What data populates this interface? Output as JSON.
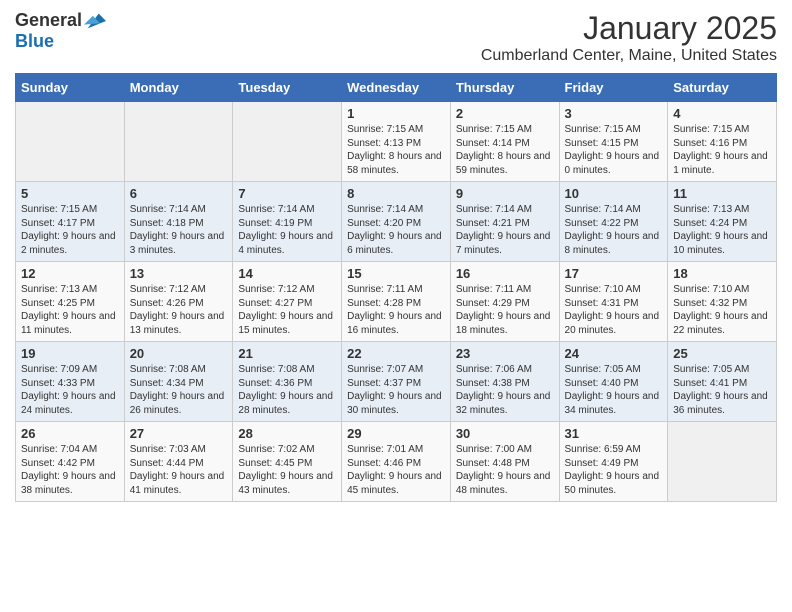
{
  "logo": {
    "general": "General",
    "blue": "Blue"
  },
  "header": {
    "month": "January 2025",
    "location": "Cumberland Center, Maine, United States"
  },
  "weekdays": [
    "Sunday",
    "Monday",
    "Tuesday",
    "Wednesday",
    "Thursday",
    "Friday",
    "Saturday"
  ],
  "weeks": [
    [
      {
        "day": "",
        "sunrise": "",
        "sunset": "",
        "daylight": ""
      },
      {
        "day": "",
        "sunrise": "",
        "sunset": "",
        "daylight": ""
      },
      {
        "day": "",
        "sunrise": "",
        "sunset": "",
        "daylight": ""
      },
      {
        "day": "1",
        "sunrise": "Sunrise: 7:15 AM",
        "sunset": "Sunset: 4:13 PM",
        "daylight": "Daylight: 8 hours and 58 minutes."
      },
      {
        "day": "2",
        "sunrise": "Sunrise: 7:15 AM",
        "sunset": "Sunset: 4:14 PM",
        "daylight": "Daylight: 8 hours and 59 minutes."
      },
      {
        "day": "3",
        "sunrise": "Sunrise: 7:15 AM",
        "sunset": "Sunset: 4:15 PM",
        "daylight": "Daylight: 9 hours and 0 minutes."
      },
      {
        "day": "4",
        "sunrise": "Sunrise: 7:15 AM",
        "sunset": "Sunset: 4:16 PM",
        "daylight": "Daylight: 9 hours and 1 minute."
      }
    ],
    [
      {
        "day": "5",
        "sunrise": "Sunrise: 7:15 AM",
        "sunset": "Sunset: 4:17 PM",
        "daylight": "Daylight: 9 hours and 2 minutes."
      },
      {
        "day": "6",
        "sunrise": "Sunrise: 7:14 AM",
        "sunset": "Sunset: 4:18 PM",
        "daylight": "Daylight: 9 hours and 3 minutes."
      },
      {
        "day": "7",
        "sunrise": "Sunrise: 7:14 AM",
        "sunset": "Sunset: 4:19 PM",
        "daylight": "Daylight: 9 hours and 4 minutes."
      },
      {
        "day": "8",
        "sunrise": "Sunrise: 7:14 AM",
        "sunset": "Sunset: 4:20 PM",
        "daylight": "Daylight: 9 hours and 6 minutes."
      },
      {
        "day": "9",
        "sunrise": "Sunrise: 7:14 AM",
        "sunset": "Sunset: 4:21 PM",
        "daylight": "Daylight: 9 hours and 7 minutes."
      },
      {
        "day": "10",
        "sunrise": "Sunrise: 7:14 AM",
        "sunset": "Sunset: 4:22 PM",
        "daylight": "Daylight: 9 hours and 8 minutes."
      },
      {
        "day": "11",
        "sunrise": "Sunrise: 7:13 AM",
        "sunset": "Sunset: 4:24 PM",
        "daylight": "Daylight: 9 hours and 10 minutes."
      }
    ],
    [
      {
        "day": "12",
        "sunrise": "Sunrise: 7:13 AM",
        "sunset": "Sunset: 4:25 PM",
        "daylight": "Daylight: 9 hours and 11 minutes."
      },
      {
        "day": "13",
        "sunrise": "Sunrise: 7:12 AM",
        "sunset": "Sunset: 4:26 PM",
        "daylight": "Daylight: 9 hours and 13 minutes."
      },
      {
        "day": "14",
        "sunrise": "Sunrise: 7:12 AM",
        "sunset": "Sunset: 4:27 PM",
        "daylight": "Daylight: 9 hours and 15 minutes."
      },
      {
        "day": "15",
        "sunrise": "Sunrise: 7:11 AM",
        "sunset": "Sunset: 4:28 PM",
        "daylight": "Daylight: 9 hours and 16 minutes."
      },
      {
        "day": "16",
        "sunrise": "Sunrise: 7:11 AM",
        "sunset": "Sunset: 4:29 PM",
        "daylight": "Daylight: 9 hours and 18 minutes."
      },
      {
        "day": "17",
        "sunrise": "Sunrise: 7:10 AM",
        "sunset": "Sunset: 4:31 PM",
        "daylight": "Daylight: 9 hours and 20 minutes."
      },
      {
        "day": "18",
        "sunrise": "Sunrise: 7:10 AM",
        "sunset": "Sunset: 4:32 PM",
        "daylight": "Daylight: 9 hours and 22 minutes."
      }
    ],
    [
      {
        "day": "19",
        "sunrise": "Sunrise: 7:09 AM",
        "sunset": "Sunset: 4:33 PM",
        "daylight": "Daylight: 9 hours and 24 minutes."
      },
      {
        "day": "20",
        "sunrise": "Sunrise: 7:08 AM",
        "sunset": "Sunset: 4:34 PM",
        "daylight": "Daylight: 9 hours and 26 minutes."
      },
      {
        "day": "21",
        "sunrise": "Sunrise: 7:08 AM",
        "sunset": "Sunset: 4:36 PM",
        "daylight": "Daylight: 9 hours and 28 minutes."
      },
      {
        "day": "22",
        "sunrise": "Sunrise: 7:07 AM",
        "sunset": "Sunset: 4:37 PM",
        "daylight": "Daylight: 9 hours and 30 minutes."
      },
      {
        "day": "23",
        "sunrise": "Sunrise: 7:06 AM",
        "sunset": "Sunset: 4:38 PM",
        "daylight": "Daylight: 9 hours and 32 minutes."
      },
      {
        "day": "24",
        "sunrise": "Sunrise: 7:05 AM",
        "sunset": "Sunset: 4:40 PM",
        "daylight": "Daylight: 9 hours and 34 minutes."
      },
      {
        "day": "25",
        "sunrise": "Sunrise: 7:05 AM",
        "sunset": "Sunset: 4:41 PM",
        "daylight": "Daylight: 9 hours and 36 minutes."
      }
    ],
    [
      {
        "day": "26",
        "sunrise": "Sunrise: 7:04 AM",
        "sunset": "Sunset: 4:42 PM",
        "daylight": "Daylight: 9 hours and 38 minutes."
      },
      {
        "day": "27",
        "sunrise": "Sunrise: 7:03 AM",
        "sunset": "Sunset: 4:44 PM",
        "daylight": "Daylight: 9 hours and 41 minutes."
      },
      {
        "day": "28",
        "sunrise": "Sunrise: 7:02 AM",
        "sunset": "Sunset: 4:45 PM",
        "daylight": "Daylight: 9 hours and 43 minutes."
      },
      {
        "day": "29",
        "sunrise": "Sunrise: 7:01 AM",
        "sunset": "Sunset: 4:46 PM",
        "daylight": "Daylight: 9 hours and 45 minutes."
      },
      {
        "day": "30",
        "sunrise": "Sunrise: 7:00 AM",
        "sunset": "Sunset: 4:48 PM",
        "daylight": "Daylight: 9 hours and 48 minutes."
      },
      {
        "day": "31",
        "sunrise": "Sunrise: 6:59 AM",
        "sunset": "Sunset: 4:49 PM",
        "daylight": "Daylight: 9 hours and 50 minutes."
      },
      {
        "day": "",
        "sunrise": "",
        "sunset": "",
        "daylight": ""
      }
    ]
  ]
}
